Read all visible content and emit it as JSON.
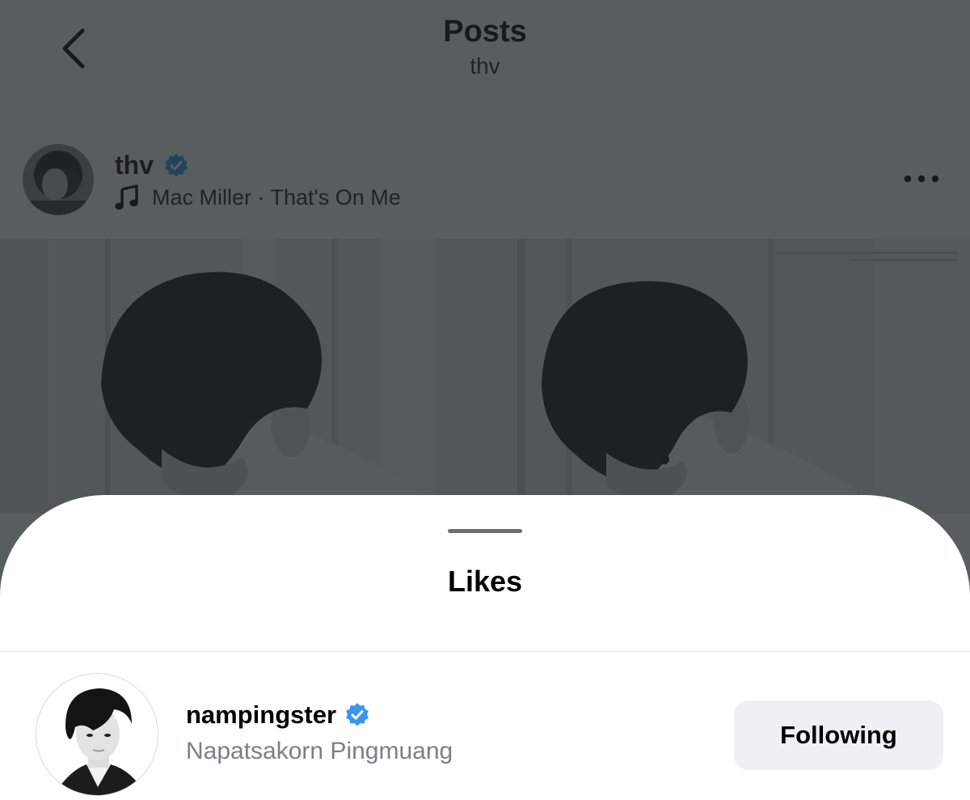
{
  "header": {
    "title": "Posts",
    "subtitle": "thv"
  },
  "post": {
    "author": {
      "username": "thv",
      "verified": true
    },
    "music": "Mac Miller · That's On Me",
    "icons": {
      "back": "chevron-left-icon",
      "music": "music-note-icon",
      "more": "more-horizontal-icon",
      "verified": "verified-badge-icon"
    }
  },
  "likes_sheet": {
    "title": "Likes",
    "items": [
      {
        "username": "nampingster",
        "full_name": "Napatsakorn Pingmuang",
        "verified": true,
        "button_label": "Following"
      }
    ]
  },
  "colors": {
    "verified_badge": "#3897f0",
    "overlay": "#1e2428",
    "button_bg": "#eff0f3",
    "secondary_text": "#7b7f86"
  }
}
